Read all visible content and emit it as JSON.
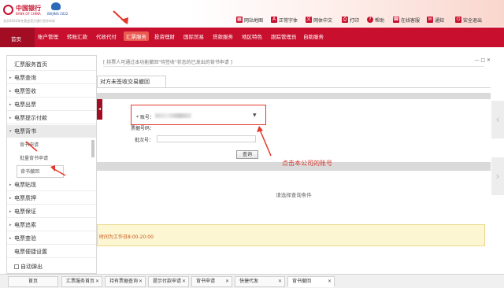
{
  "brand": {
    "bank_name": "中国银行",
    "bank_name_en": "BANK OF CHINA",
    "slogan": "北京2022年冬奥会官方银行合作伙伴",
    "olympic_text": "BEIJING 2022"
  },
  "utility_links": [
    {
      "label": "网站地图",
      "icon": "sitemap-icon"
    },
    {
      "label": "正常字体",
      "icon": "font-icon"
    },
    {
      "label": "网体中文",
      "icon": "language-icon"
    },
    {
      "label": "打印",
      "icon": "print-icon"
    },
    {
      "label": "帮助",
      "icon": "help-icon"
    },
    {
      "label": "在线客服",
      "icon": "chat-icon"
    },
    {
      "label": "通知",
      "icon": "bell-icon"
    },
    {
      "label": "安全退出",
      "icon": "logout-icon"
    }
  ],
  "nav": {
    "home": "首页",
    "items": [
      "账户管理",
      "转账汇款",
      "代收代付",
      "汇票服务",
      "投资理财",
      "国际贸易",
      "贷款服务",
      "地区特色",
      "跟踪管理员",
      "自助服务"
    ],
    "active_index": 3
  },
  "sidebar": {
    "items": [
      {
        "label": "汇票服务首页",
        "type": "item"
      },
      {
        "label": "电票查询",
        "type": "folder"
      },
      {
        "label": "电票签收",
        "type": "folder"
      },
      {
        "label": "电票出票",
        "type": "folder"
      },
      {
        "label": "电票提示付款",
        "type": "folder"
      },
      {
        "label": "电票背书",
        "type": "open-folder"
      },
      {
        "label": "背书申请",
        "type": "sub"
      },
      {
        "label": "批量背书申请",
        "type": "sub"
      },
      {
        "label": "背书撤回",
        "type": "sub-selected"
      },
      {
        "label": "电票贴现",
        "type": "folder"
      },
      {
        "label": "电票质押",
        "type": "folder"
      },
      {
        "label": "电票保证",
        "type": "folder"
      },
      {
        "label": "电票追索",
        "type": "folder"
      },
      {
        "label": "电票查验",
        "type": "folder"
      },
      {
        "label": "电票便捷设置",
        "type": "item"
      }
    ],
    "auto_popup": "自动弹出"
  },
  "main": {
    "notice": "[ 持票人可通过本功能撤回\"待签收\"状态的已发出的背书申请 ]",
    "window_controls": "— □ ✕",
    "tab_title": "对方未签收交易撤回",
    "form": {
      "account_label": "* 账号：",
      "account_value": "",
      "bill_no_label": "票据号码：",
      "batch_no_label": "批次号：",
      "query_button": "查询"
    },
    "hint": "请选择查询条件",
    "hours_text": "时间为工作日8:00-20:00"
  },
  "annotation": "点击本公司的账号",
  "bottom_tabs": [
    {
      "label": "首页",
      "closable": false
    },
    {
      "label": "汇票服务首页",
      "closable": true
    },
    {
      "label": "持有票据查询",
      "closable": true
    },
    {
      "label": "提示付款申请",
      "closable": true
    },
    {
      "label": "背书申请",
      "closable": true
    },
    {
      "label": "快捷代发",
      "closable": true
    },
    {
      "label": "背书撤回",
      "closable": true,
      "active": true
    }
  ],
  "colors": {
    "brand_red": "#c8102e",
    "annotation_red": "#e2382c"
  }
}
